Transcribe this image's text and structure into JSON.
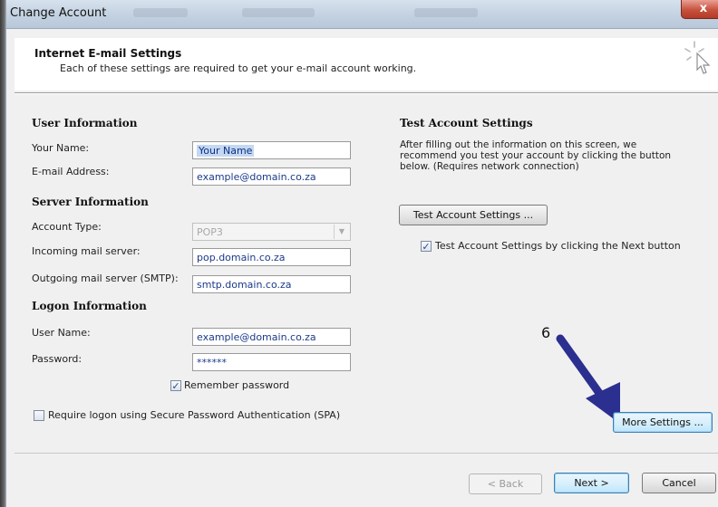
{
  "window": {
    "title": "Change Account",
    "close_glyph": "x"
  },
  "header": {
    "title": "Internet E-mail Settings",
    "subtitle": "Each of these settings are required to get your e-mail account working."
  },
  "user_info": {
    "heading": "User Information",
    "name_label": "Your Name:",
    "name_value": "Your Name",
    "email_label": "E-mail Address:",
    "email_value": "example@domain.co.za"
  },
  "server_info": {
    "heading": "Server Information",
    "account_type_label": "Account Type:",
    "account_type_value": "POP3",
    "incoming_label": "Incoming mail server:",
    "incoming_value": "pop.domain.co.za",
    "outgoing_label": "Outgoing mail server (SMTP):",
    "outgoing_value": "smtp.domain.co.za"
  },
  "logon_info": {
    "heading": "Logon Information",
    "user_label": "User Name:",
    "user_value": "example@domain.co.za",
    "password_label": "Password:",
    "password_value": "******",
    "remember_label": "Remember password",
    "remember_checked": true,
    "spa_label": "Require logon using Secure Password Authentication (SPA)",
    "spa_checked": false
  },
  "test": {
    "heading": "Test Account Settings",
    "description_1": "After filling out the information on this screen, we",
    "description_2": "recommend you test your account by clicking the button",
    "description_3": "below. (Requires network connection)",
    "button_label": "Test Account Settings ...",
    "auto_test_label": "Test Account Settings by clicking the Next button",
    "auto_test_checked": true
  },
  "more_settings_label": "More Settings ...",
  "annotation": {
    "number": "6",
    "arrow_color": "#2b2f8f"
  },
  "footer": {
    "back_label": "< Back",
    "next_label": "Next >",
    "cancel_label": "Cancel"
  },
  "icons": {
    "check": "✓",
    "dropdown": "▼"
  }
}
